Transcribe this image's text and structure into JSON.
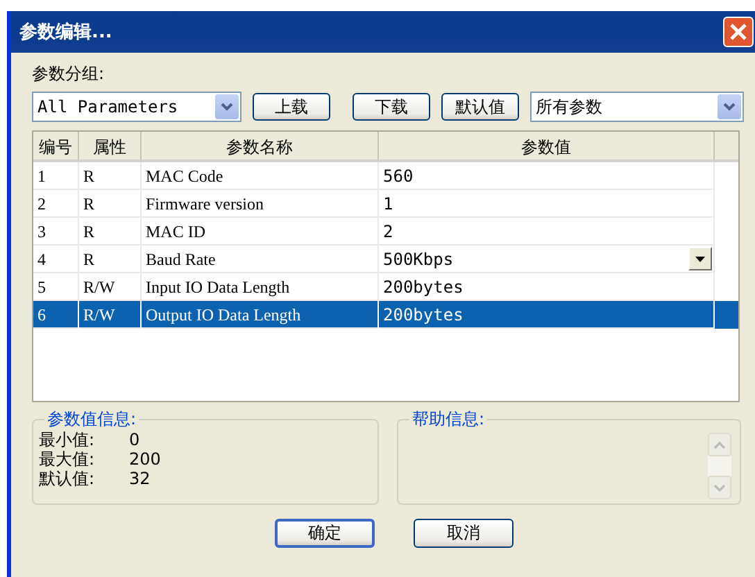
{
  "window": {
    "title": "参数编辑..."
  },
  "group_label": "参数分组:",
  "group_select": {
    "value": "All Parameters"
  },
  "buttons_top": [
    "上载",
    "下载",
    "默认值"
  ],
  "filter_select": {
    "value": "所有参数"
  },
  "table": {
    "columns": [
      "编号",
      "属性",
      "参数名称",
      "参数值"
    ],
    "rows": [
      {
        "cells": [
          "1",
          "R",
          "MAC Code",
          "560"
        ],
        "kind": "text",
        "selected": false
      },
      {
        "cells": [
          "2",
          "R",
          "Firmware version",
          "1"
        ],
        "kind": "text",
        "selected": false
      },
      {
        "cells": [
          "3",
          "R",
          "MAC ID",
          "2"
        ],
        "kind": "text",
        "selected": false
      },
      {
        "cells": [
          "4",
          "R",
          "Baud Rate",
          "500Kbps"
        ],
        "kind": "dropdown",
        "selected": false
      },
      {
        "cells": [
          "5",
          "R/W",
          "Input IO Data Length",
          "200bytes"
        ],
        "kind": "text",
        "selected": false
      },
      {
        "cells": [
          "6",
          "R/W",
          "Output IO Data Length",
          "200bytes"
        ],
        "kind": "text",
        "selected": true
      }
    ]
  },
  "value_info": {
    "title": "参数值信息:",
    "items": [
      {
        "label": "最小值:",
        "value": "0"
      },
      {
        "label": "最大值:",
        "value": "200"
      },
      {
        "label": "默认值:",
        "value": "32"
      }
    ]
  },
  "help_info": {
    "title": "帮助信息:"
  },
  "buttons_bottom": [
    "确定",
    "取消"
  ]
}
